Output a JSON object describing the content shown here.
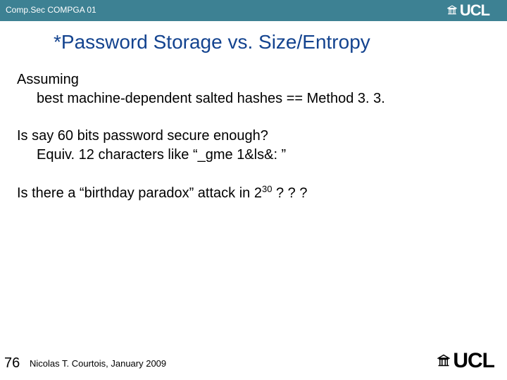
{
  "header": {
    "course": "Comp.Sec COMPGA 01",
    "logo_text": "UCL"
  },
  "title": "*Password Storage vs. Size/Entropy",
  "body": {
    "p1_line1": "Assuming",
    "p1_line2": "best machine-dependent salted hashes == Method 3. 3.",
    "p2_line1": "Is say 60 bits password secure enough?",
    "p2_line2": "Equiv. 12 characters like “_gme 1&ls&: ”",
    "p3_pre": "Is there a “birthday paradox” attack in 2",
    "p3_exp": "30",
    "p3_post": " ? ? ?"
  },
  "footer": {
    "page": "76",
    "credit": "Nicolas T. Courtois, January 2009",
    "logo_text": "UCL"
  }
}
